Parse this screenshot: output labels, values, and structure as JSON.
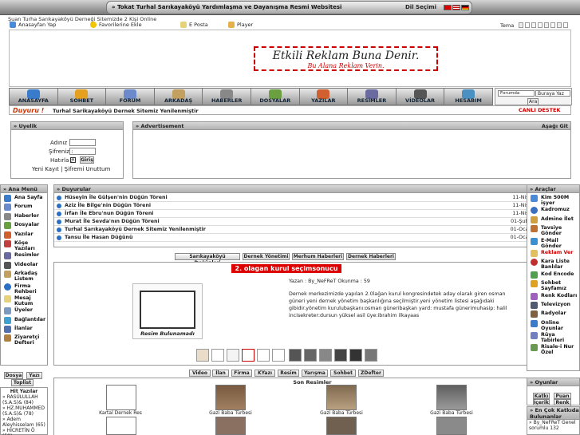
{
  "top": {
    "title": "» Tokat Turhal Sarıkayaköyü Yardımlaşma ve Dayanışma Resmi Websitesi",
    "lang_label": "Dil Seçimi"
  },
  "online_text": "Şuan Turha Sarıkayaköyü Derneği Sitemizde 2 Kişi Online",
  "links": [
    "Anasayfan Yap",
    "Favorilerine Ekle",
    "E Posta",
    "Player"
  ],
  "tema_label": "Tema",
  "ad": {
    "line1": "Etkili Reklam Buna Denir.",
    "line2": "Bu Alana Reklam Verin."
  },
  "nav": [
    "ANASAYFA",
    "SOHBET",
    "FORUM",
    "ARKADAŞ",
    "HABERLER",
    "DOSYALAR",
    "YAZILAR",
    "RESİMLER",
    "VİDEOLAR",
    "HESABIM"
  ],
  "search": {
    "select": "Forumda",
    "value": "Buraya Yaz",
    "button": "Ara"
  },
  "duyuru": {
    "label": "Duyuru !",
    "text": "Turhal Sarikayaköyü Dernek Sitemiz Yenilenmiştir",
    "support": "CANLI DESTEK"
  },
  "uyelik": {
    "title": "» Uyelik",
    "user_label": "Adınız :",
    "pass_label": "Şifreniz :",
    "remember": "Hatırla :",
    "login": "Giriş",
    "links": "Yeni Kayıt | Şifremi Unuttum"
  },
  "advert": {
    "title": "» Advertisement",
    "down": "Aşağı Git"
  },
  "menu": {
    "title": "» Ana Menü",
    "items": [
      "Ana Sayfa",
      "Forum",
      "Haberler",
      "Dosyalar",
      "Yazılar",
      "Köşe Yazıları",
      "Resimler",
      "Videolar",
      "Arkadaş Listem",
      "Firma Rehberi",
      "Mesaj Kutum",
      "Üyeler",
      "Bağlantılar",
      "İlanlar",
      "Ziyaretçi Defteri"
    ]
  },
  "announcements": {
    "title": "» Duyurular",
    "rows": [
      {
        "text": "Hüseyin İle Gülşen'nin Düğün Töreni",
        "date": "11-Nis-2011 18:47:08"
      },
      {
        "text": "Aziz İle Bilge'nin Düğün Töreni",
        "date": "11-Nis-2011 18:38:05"
      },
      {
        "text": "İrfan İle Ebru'nun Düğün Töreni",
        "date": "11-Nis-2011 18:20:08"
      },
      {
        "text": "Murat İle Sevda'nın Düğün Töreni",
        "date": "01-Şub-2011 22:44:54"
      },
      {
        "text": "Turhal Sarıkayaköyü Dernek Sitemiz Yenilenmiştir",
        "date": "01-Oca-2009 00:00:00"
      },
      {
        "text": "Tansu İle Hasan Düğünü",
        "date": "01-Oca-2009 00:00:00"
      }
    ]
  },
  "news_tabs": [
    "Sarıkayaköyü Duğünleri",
    "Dernek Yönetimi",
    "Merhum Haberleri",
    "Dernek Haberleri"
  ],
  "news": {
    "headline": "2. olagan kurul seçimsonucu",
    "meta": "Yazan : By_NeFReT Okunma : 59",
    "body": "Dernek merkezimizde yapılan 2.0lağan kurul kongresindetek aday olarak giren osman güneri yeni dernek yönetim başkanlığına seçilmiştir.yeni yönetim listesi aşağıdaki gibidir.yönetim kurulubaşkanı:osman güneribaşkan yard: mustafa günerimuhasip: halil incisekreter:dursun yüksel asil üye:ibrahim ilkayaas",
    "no_image": "Resim Bulunamadı"
  },
  "media_tabs": [
    "Video",
    "İlan",
    "Firma",
    "KYazı",
    "Resim",
    "Yarışma",
    "Sohbet",
    "ZDefter"
  ],
  "recent": {
    "title": "Son Resimler",
    "captions": [
      "Kartal Dernek Res",
      "Gazi Baba Türbesi",
      "Gazi Baba Türbesi",
      "Gazi Baba Türbesi"
    ]
  },
  "tools": {
    "title": "» Araçlar",
    "items": [
      "Kim 500M işyer",
      "Kadromuz",
      "Admine İlet",
      "Tavsiye Gönder",
      "E-Mail Gönder",
      "Reklam Ver",
      "Kara Liste Banlılar",
      "Kod Encode",
      "Sohbet Sayfamız",
      "Renk Kodları",
      "Televizyon",
      "Radyolar",
      "Online Oyunlar",
      "Rüya Tabirleri",
      "Risale-i Nur Özel"
    ]
  },
  "games": {
    "title": "» Oyunlar",
    "buttons": [
      "Katkı",
      "Puan",
      "İçerik",
      "Renk"
    ]
  },
  "top_contrib": {
    "title": "» En Çok Katkıda Bulunanlar",
    "line": "» By_NeFReT Genel",
    "line2": "sorumlu 132"
  },
  "left_tabs": [
    "Dosya",
    "Yazı",
    "Toplist"
  ],
  "hit": {
    "title": "Hit Yazılar",
    "items": [
      "» RASÜLULLAH (S.A.S)& (84)",
      "» HZ.MUHAMMED (S.A.S)& (78)",
      "» Adem Aleyhisselam (65)",
      "» HİCRETİN Ö (58)"
    ]
  }
}
